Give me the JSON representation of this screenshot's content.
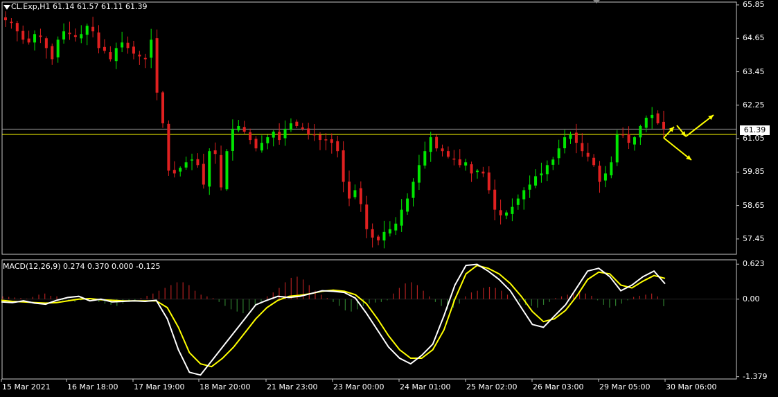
{
  "chart_data": [
    {
      "type": "candlestick",
      "title": "CL.Exp,H1  61.14 61.57 61.11 61.39",
      "symbol": "CL.Exp",
      "timeframe": "H1",
      "last_bar": {
        "open": 61.14,
        "high": 61.57,
        "low": 61.11,
        "close": 61.39
      },
      "ylim": [
        56.9,
        65.95
      ],
      "y_ticks": [
        "65.85",
        "64.65",
        "63.45",
        "62.25",
        "61.05",
        "59.85",
        "58.65",
        "57.45"
      ],
      "current_price": "61.39",
      "horizontal_lines": [
        {
          "price": 61.39,
          "color": "#9a9a9a"
        },
        {
          "price": 61.2,
          "color": "#ffff00"
        }
      ],
      "x_ticks": [
        "15 Mar 2021",
        "16 Mar 18:00",
        "17 Mar 19:00",
        "18 Mar 20:00",
        "21 Mar 23:00",
        "23 Mar 00:00",
        "24 Mar 01:00",
        "25 Mar 02:00",
        "26 Mar 03:00",
        "29 Mar 05:00",
        "30 Mar 06:00"
      ],
      "series": [
        {
          "values": [
            65.3,
            65.2,
            64.9,
            64.6,
            64.5,
            64.8,
            64.7,
            64.3,
            63.9,
            64.6,
            64.9,
            64.8,
            64.7,
            64.8,
            65.1,
            64.9,
            64.3,
            64.2,
            63.9,
            64.3,
            64.5,
            64.3,
            64.1,
            64.0,
            63.9,
            64.6,
            62.7,
            61.6,
            59.9,
            59.8,
            60.0,
            60.2,
            60.3,
            60.1,
            59.4,
            60.6,
            60.5,
            59.3,
            60.6,
            61.4,
            61.5,
            61.3,
            61.0,
            60.7,
            60.9,
            61.1,
            61.3,
            61.0,
            61.4,
            61.6,
            61.5,
            61.4,
            61.2,
            61.2,
            61.0,
            61.0,
            60.9,
            60.6,
            59.5,
            58.9,
            59.2,
            58.7,
            57.8,
            57.5,
            57.4,
            57.7,
            57.8,
            58.0,
            58.5,
            58.9,
            59.5,
            60.1,
            60.6,
            61.1,
            60.7,
            60.6,
            60.4,
            60.3,
            60.1,
            60.2,
            59.8,
            59.9,
            59.8,
            59.2,
            58.5,
            58.3,
            58.4,
            58.6,
            58.9,
            59.2,
            59.4,
            59.7,
            59.8,
            60.1,
            60.3,
            60.7,
            61.1,
            61.2,
            60.9,
            60.6,
            60.4,
            60.1,
            59.5,
            59.8,
            60.2,
            61.2,
            61.2,
            60.9,
            61.1,
            61.5,
            61.8,
            61.9,
            61.6,
            61.4
          ]
        }
      ]
    },
    {
      "type": "macd",
      "title": "MACD(12,26,9)  0.274  0.370  0.000  -0.125",
      "params": "12,26,9",
      "readout": [
        0.274,
        0.37,
        0.0,
        -0.125
      ],
      "ylim": [
        -1.42,
        0.7
      ],
      "y_ticks": [
        "0.623",
        "0.00",
        "-1.379"
      ],
      "colors": {
        "macd_line": "#ffffff",
        "signal_line": "#ffff00",
        "hist_pos": "#b02020",
        "hist_neg": "#2e7d2e"
      },
      "macd_values": [
        -0.05,
        -0.06,
        -0.03,
        -0.07,
        -0.09,
        -0.02,
        0.03,
        0.05,
        -0.03,
        0.0,
        -0.05,
        -0.04,
        -0.03,
        -0.04,
        -0.02,
        -0.35,
        -0.9,
        -1.3,
        -1.35,
        -1.1,
        -0.85,
        -0.6,
        -0.35,
        -0.1,
        -0.02,
        0.05,
        0.03,
        0.05,
        0.1,
        0.15,
        0.14,
        0.12,
        0.02,
        -0.25,
        -0.55,
        -0.85,
        -1.05,
        -1.15,
        -1.0,
        -0.8,
        -0.3,
        0.25,
        0.6,
        0.62,
        0.5,
        0.35,
        0.15,
        -0.15,
        -0.45,
        -0.5,
        -0.3,
        -0.1,
        0.2,
        0.5,
        0.55,
        0.4,
        0.15,
        0.25,
        0.4,
        0.5,
        0.274
      ],
      "signal_values": [
        -0.02,
        -0.04,
        -0.05,
        -0.06,
        -0.07,
        -0.06,
        -0.03,
        0.0,
        0.01,
        -0.01,
        -0.02,
        -0.03,
        -0.03,
        -0.03,
        -0.03,
        -0.15,
        -0.5,
        -0.95,
        -1.15,
        -1.2,
        -1.05,
        -0.85,
        -0.6,
        -0.35,
        -0.15,
        -0.02,
        0.05,
        0.07,
        0.1,
        0.14,
        0.16,
        0.14,
        0.08,
        -0.08,
        -0.35,
        -0.65,
        -0.9,
        -1.05,
        -1.05,
        -0.9,
        -0.55,
        0.0,
        0.45,
        0.6,
        0.55,
        0.45,
        0.28,
        0.05,
        -0.22,
        -0.4,
        -0.35,
        -0.2,
        0.05,
        0.35,
        0.48,
        0.45,
        0.25,
        0.2,
        0.32,
        0.42,
        0.37
      ],
      "hist_values": [
        0.05,
        0.04,
        0.03,
        0.02,
        0.01,
        0.04,
        0.08,
        0.1,
        0.06,
        0.05,
        -0.02,
        -0.03,
        -0.05,
        -0.02,
        0.0,
        -0.02,
        -0.05,
        -0.08,
        -0.1,
        -0.12,
        -0.08,
        -0.05,
        -0.02,
        0.02,
        0.06,
        0.1,
        0.15,
        0.2,
        0.25,
        0.3,
        0.3,
        0.25,
        0.15,
        0.08,
        0.05,
        0.02,
        -0.05,
        -0.12,
        -0.18,
        -0.22,
        -0.25,
        -0.2,
        -0.1,
        -0.05,
        0.05,
        0.12,
        0.2,
        0.3,
        0.38,
        0.4,
        0.35,
        0.25,
        0.15,
        0.08,
        0.02,
        -0.05,
        -0.12,
        -0.2,
        -0.22,
        -0.18,
        -0.12,
        -0.08,
        -0.06,
        -0.05,
        -0.02,
        0.1,
        0.2,
        0.28,
        0.3,
        0.25,
        0.15,
        0.05,
        -0.05,
        -0.12,
        -0.18,
        -0.15,
        -0.08,
        0.05,
        0.12,
        0.15,
        0.2,
        0.22,
        0.2,
        0.15,
        0.08,
        0.0,
        -0.05,
        -0.1,
        -0.12,
        -0.15,
        -0.1,
        -0.05,
        0.02,
        0.05,
        0.08,
        0.1,
        0.12,
        0.1,
        0.06,
        -0.02,
        -0.1,
        -0.15,
        -0.12,
        -0.08,
        -0.02,
        0.04,
        0.06,
        0.08,
        0.1,
        0.05,
        -0.125
      ]
    }
  ],
  "annotation_arrows_color": "#ffff00"
}
